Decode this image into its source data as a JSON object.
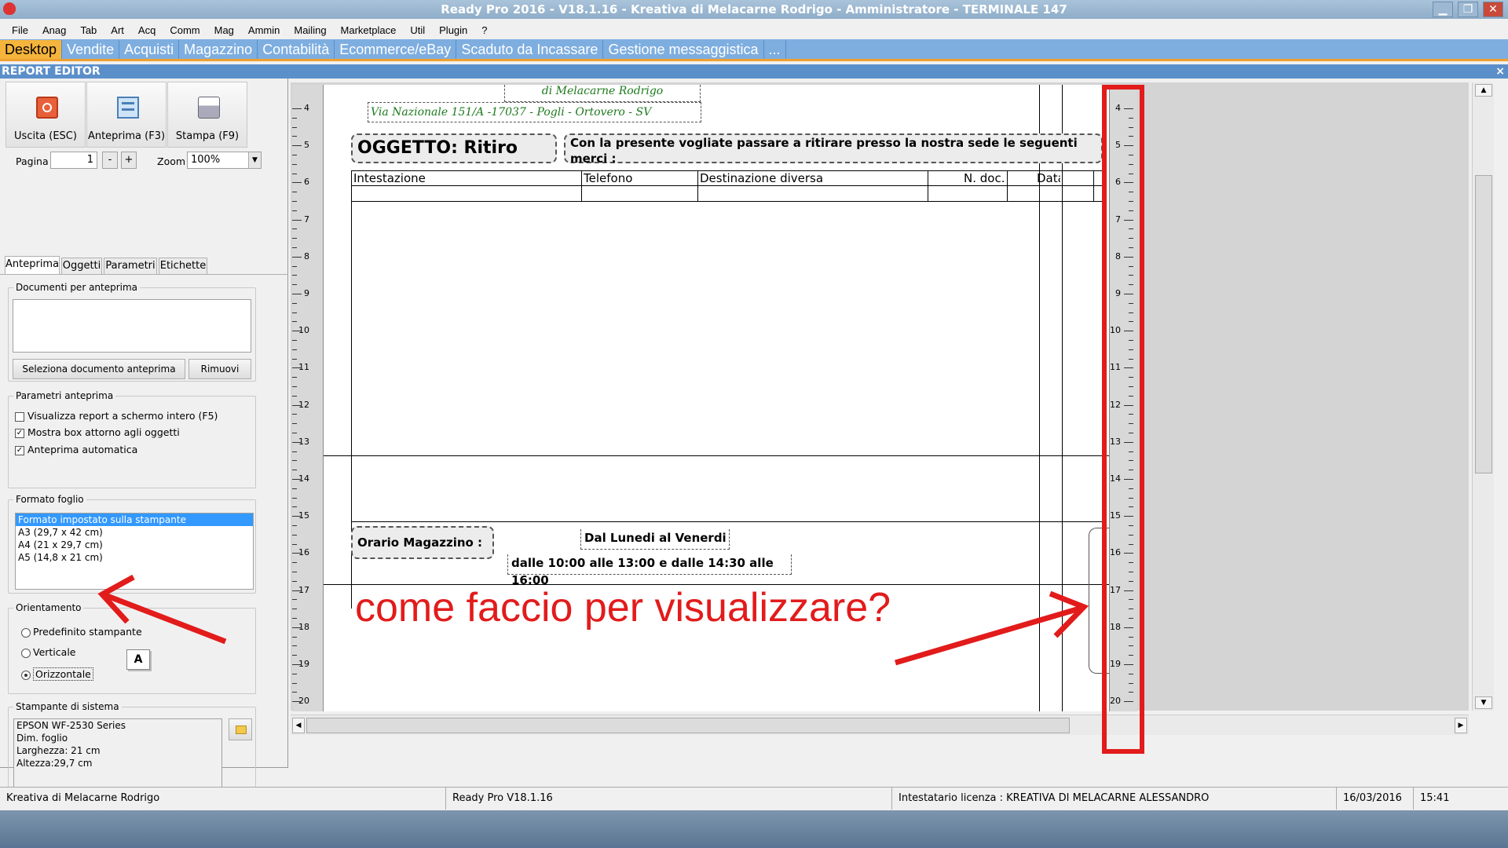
{
  "window": {
    "title": "Ready Pro 2016 - V18.1.16 - Kreativa di Melacarne Rodrigo - Amministratore - TERMINALE 147",
    "minimize": "▁",
    "restore": "❐",
    "close": "✕"
  },
  "menu": [
    "File",
    "Anag",
    "Tab",
    "Art",
    "Acq",
    "Comm",
    "Mag",
    "Ammin",
    "Mailing",
    "Marketplace",
    "Util",
    "Plugin",
    "?"
  ],
  "tabs": [
    "Desktop",
    "Vendite",
    "Acquisti",
    "Magazzino",
    "Contabilità",
    "Ecommerce/eBay",
    "Scaduto da Incassare",
    "Gestione messaggistica",
    "..."
  ],
  "active_tab": 0,
  "report_editor": {
    "title": "REPORT EDITOR",
    "close": "×"
  },
  "toolbar": {
    "exit": "Uscita (ESC)",
    "preview": "Anteprima (F3)",
    "print": "Stampa (F9)"
  },
  "pagina": {
    "label": "Pagina",
    "value": "1",
    "minus": "-",
    "plus": "+"
  },
  "zoom": {
    "label": "Zoom",
    "value": "100%"
  },
  "subtabs": [
    "Anteprima",
    "Oggetti",
    "Parametri",
    "Etichette"
  ],
  "docs_group": {
    "title": "Documenti per anteprima",
    "select_btn": "Seleziona documento anteprima",
    "remove_btn": "Rimuovi"
  },
  "params_group": {
    "title": "Parametri anteprima",
    "opts": [
      {
        "label": "Visualizza report a schermo intero (F5)",
        "checked": false
      },
      {
        "label": "Mostra box attorno agli oggetti",
        "checked": true
      },
      {
        "label": "Anteprima automatica",
        "checked": true
      }
    ]
  },
  "format_group": {
    "title": "Formato foglio",
    "items": [
      "Formato impostato sulla stampante",
      "A3 (29,7 x 42 cm)",
      "A4 (21 x 29,7 cm)",
      "A5 (14,8 x 21 cm)"
    ],
    "selected": 0
  },
  "orient_group": {
    "title": "Orientamento",
    "opts": [
      "Predefinito stampante",
      "Verticale",
      "Orizzontale"
    ],
    "selected": 2
  },
  "printer_group": {
    "title": "Stampante di sistema",
    "lines": [
      "EPSON WF-2530 Series",
      "Dim. foglio",
      "Larghezza: 21 cm",
      "Altezza:29,7 cm"
    ]
  },
  "report": {
    "company_line": "di Melacarne Rodrigo",
    "address": "Via Nazionale 151/A -17037 - Pogli - Ortovero - SV",
    "oggetto": "OGGETTO:  Ritiro",
    "intro": "Con la presente vogliate passare a ritirare presso la nostra sede le seguenti merci :",
    "columns": [
      "Intestazione",
      "Telefono",
      "Destinazione diversa",
      "N. doc.",
      "Data"
    ],
    "orario_label": "Orario Magazzino :",
    "days": "Dal Lunedi al Venerdi",
    "hours": "dalle 10:00 alle 13:00 e dalle 14:30 alle 16:00"
  },
  "ruler": [
    "4",
    "5",
    "6",
    "7",
    "8",
    "9",
    "10",
    "11",
    "12",
    "13",
    "14",
    "15",
    "16",
    "17",
    "18",
    "19",
    "20"
  ],
  "annotation": {
    "text": "come faccio per visualizzare?",
    "color": "#e21b1b"
  },
  "status": [
    "Kreativa di Melacarne Rodrigo",
    "Ready Pro V18.1.16",
    "Intestatario licenza : KREATIVA DI MELACARNE ALESSANDRO",
    "16/03/2016",
    "15:41"
  ],
  "font_badge": "A"
}
